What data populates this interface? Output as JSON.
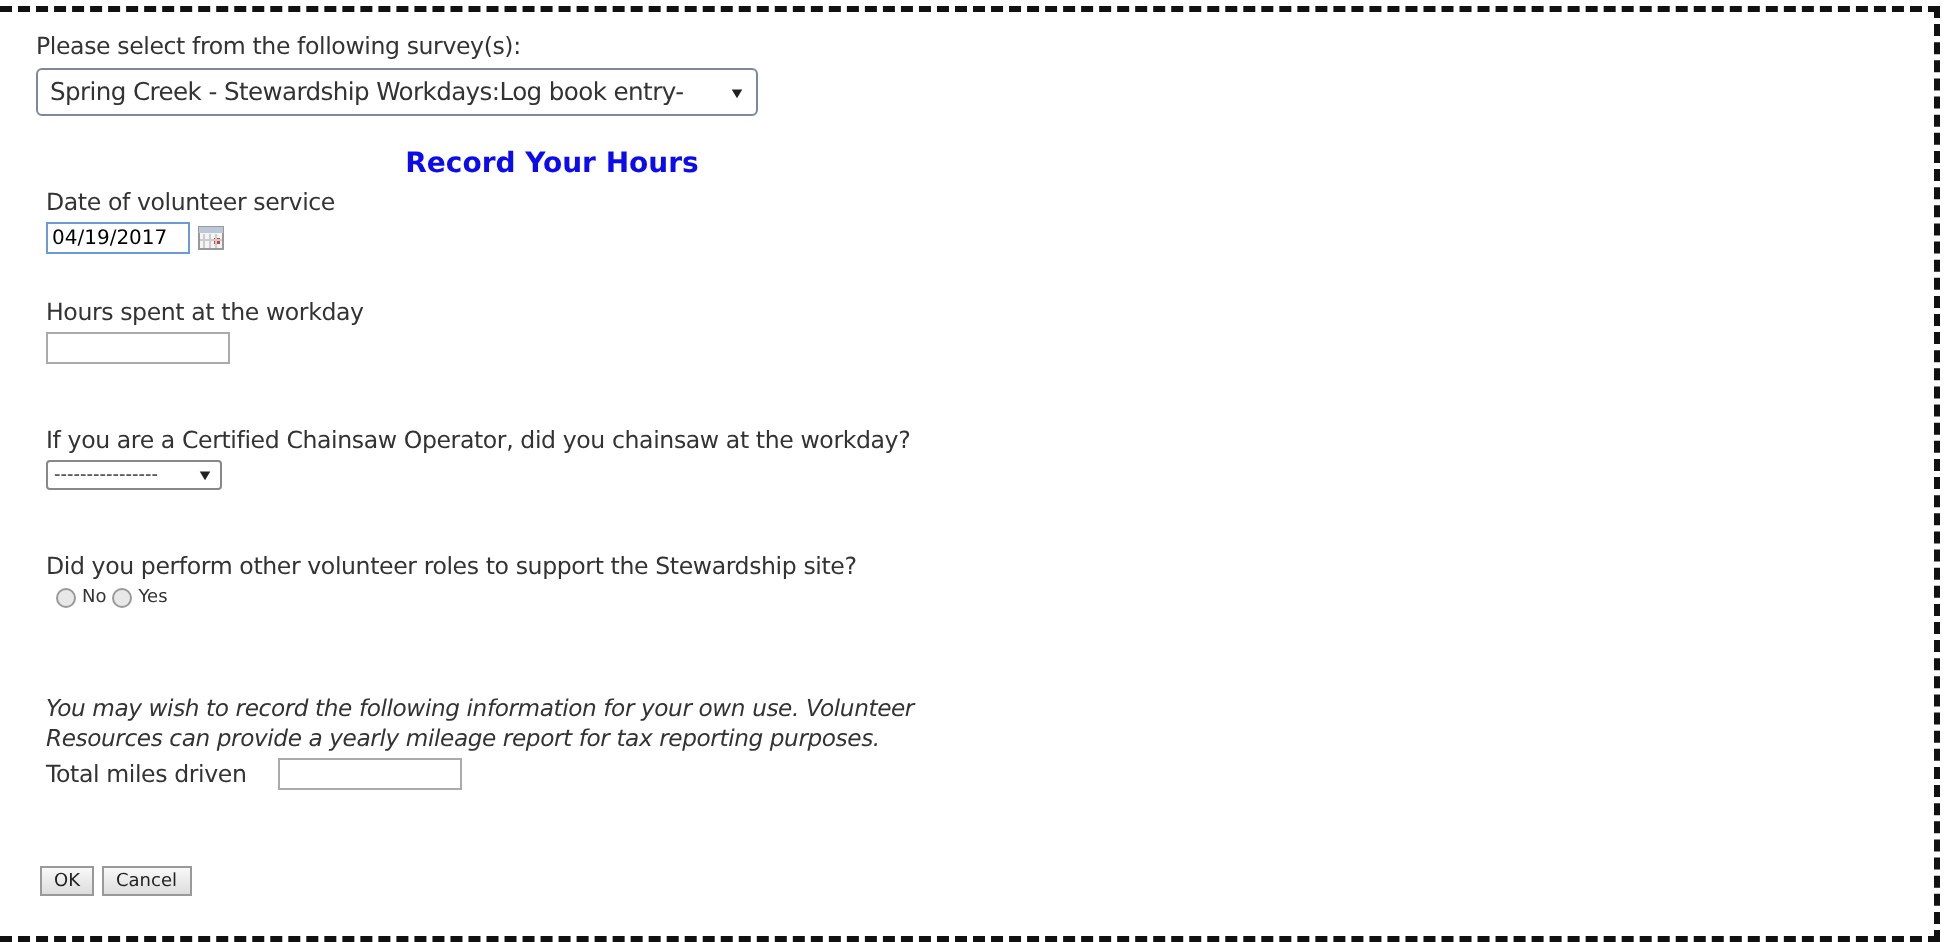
{
  "survey_select": {
    "label": "Please select from the following survey(s):",
    "value": "Spring Creek - Stewardship Workdays:Log book entry-"
  },
  "form": {
    "title": "Record Your Hours",
    "fields": [
      {
        "kind": "date",
        "label": "Date of volunteer service",
        "value": "04/19/2017"
      },
      {
        "kind": "text",
        "label": "Hours spent at the workday"
      },
      {
        "kind": "select",
        "label": "If you are a Certified Chainsaw Operator, did you chainsaw at the workday?",
        "value": "----------------"
      },
      {
        "kind": "radio",
        "label": "Did you perform other volunteer roles to support the Stewardship site?",
        "options": [
          {
            "label": "No",
            "selected": false
          },
          {
            "label": "Yes",
            "selected": false
          }
        ]
      }
    ],
    "note": "You may wish to record the following information for your own use. Volunteer Resources can provide a yearly mileage report for tax reporting purposes.",
    "miles": {
      "label": "Total miles driven"
    }
  },
  "buttons": [
    "OK",
    "Cancel"
  ]
}
